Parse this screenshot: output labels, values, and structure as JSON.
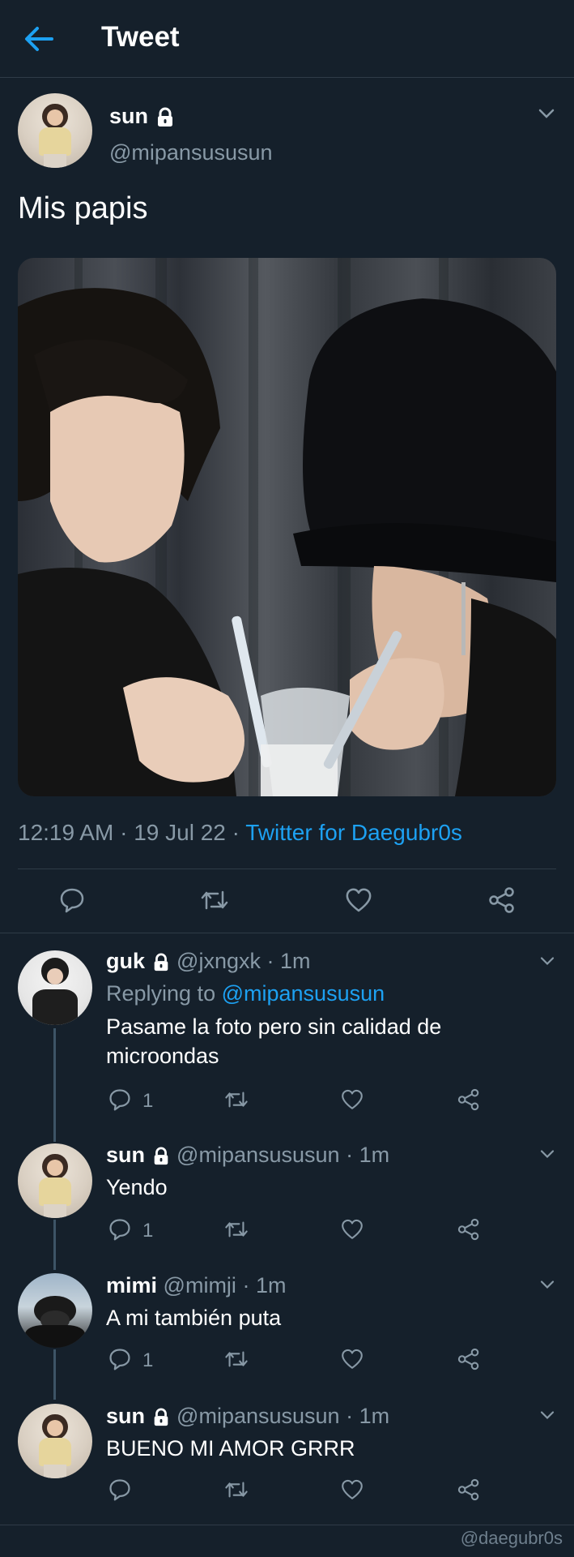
{
  "header": {
    "title": "Tweet",
    "back_icon": "arrow-left-icon"
  },
  "tweet": {
    "name": "sun",
    "handle": "@mipansususun",
    "text": "Mis papis",
    "time": "12:19 AM",
    "date": "19 Jul 22",
    "source": "Twitter for Daegubr0s",
    "separator": " · "
  },
  "replies": [
    {
      "name": "guk",
      "handle": "@jxngxk",
      "time": "1m",
      "replying_label": "Replying to",
      "replying_to": "@mipansususun",
      "text": "Pasame la foto pero sin calidad de microondas",
      "reply_count": "1"
    },
    {
      "name": "sun",
      "handle": "@mipansususun",
      "time": "1m",
      "text": "Yendo",
      "reply_count": "1"
    },
    {
      "name": "mimi",
      "handle": "@mimji",
      "time": "1m",
      "text": "A mi también puta",
      "reply_count": "1"
    },
    {
      "name": "sun",
      "handle": "@mipansususun",
      "time": "1m",
      "text": "BUENO MI AMOR GRRR",
      "reply_count": ""
    }
  ],
  "watermark": "@daegubr0s",
  "colors": {
    "background": "#15202b",
    "accent": "#1da1f2",
    "muted": "#8899a6",
    "divider": "#2f3b47"
  }
}
